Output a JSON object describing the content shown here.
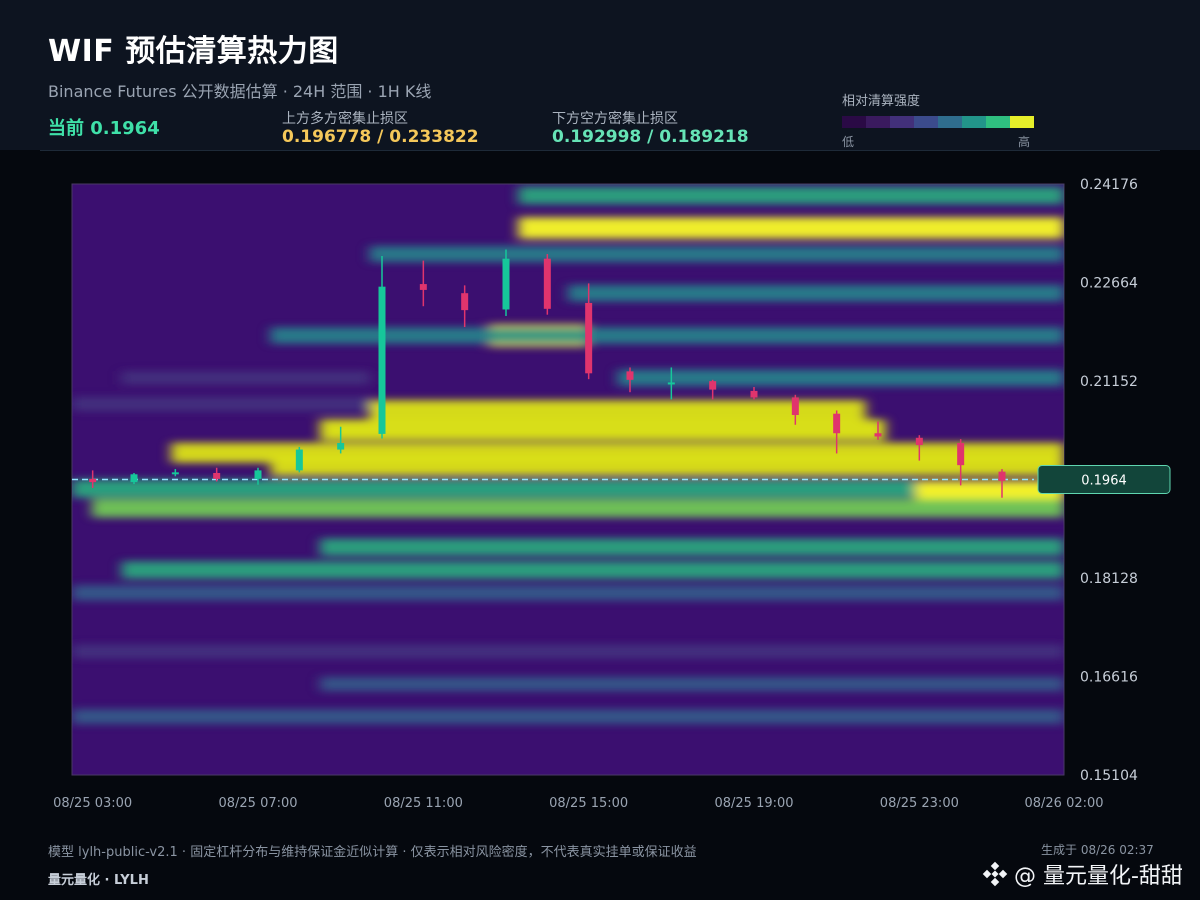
{
  "header": {
    "title": "WIF 预估清算热力图",
    "subtitle": "Binance Futures 公开数据估算 · 24H 范围 · 1H K线",
    "current": "当前 0.1964",
    "upper_zone_label": "上方多方密集止损区",
    "upper_zone_value": "0.196778 / 0.233822",
    "lower_zone_label": "下方空方密集止损区",
    "lower_zone_value": "0.192998 / 0.189218",
    "scale_title": "相对清算强度",
    "scale_low": "低",
    "scale_high": "高",
    "scale_colors": [
      "#2a0a45",
      "#3a1a5e",
      "#42307a",
      "#3b4b8c",
      "#2f6d8e",
      "#22958a",
      "#2fbf80",
      "#e6ef2a"
    ]
  },
  "chart_data": {
    "type": "heatmap",
    "title": "WIF 预估清算热力图",
    "ylabel": "",
    "xlabel": "",
    "ylim": [
      0.15104,
      0.24176
    ],
    "yticks": [
      "0.24176",
      "0.22664",
      "0.21152",
      "0.18128",
      "0.16616",
      "0.15104"
    ],
    "xticks": [
      "08/25 03:00",
      "08/25 07:00",
      "08/25 11:00",
      "08/25 15:00",
      "08/25 19:00",
      "08/25 23:00",
      "08/26 02:00"
    ],
    "current_price": 0.1964,
    "current_price_label": "0.1964",
    "colorscale": [
      "#3b0f70",
      "#453781",
      "#33638d",
      "#238a8d",
      "#29af7f",
      "#73d055",
      "#dce319",
      "#f2f02a"
    ],
    "up_color": "#16c79a",
    "down_color": "#e0346d",
    "candles": [
      {
        "t": "08/25 03:00",
        "o": 0.1965,
        "h": 0.1978,
        "l": 0.1951,
        "c": 0.196
      },
      {
        "t": "08/25 04:00",
        "o": 0.196,
        "h": 0.1974,
        "l": 0.1957,
        "c": 0.1972
      },
      {
        "t": "08/25 05:00",
        "o": 0.1972,
        "h": 0.198,
        "l": 0.1969,
        "c": 0.1975
      },
      {
        "t": "08/25 06:00",
        "o": 0.1974,
        "h": 0.1982,
        "l": 0.1961,
        "c": 0.1965
      },
      {
        "t": "08/25 07:00",
        "o": 0.1965,
        "h": 0.1982,
        "l": 0.1956,
        "c": 0.1978
      },
      {
        "t": "08/25 08:00",
        "o": 0.1978,
        "h": 0.2014,
        "l": 0.1975,
        "c": 0.201
      },
      {
        "t": "08/25 09:00",
        "o": 0.201,
        "h": 0.2045,
        "l": 0.2004,
        "c": 0.202
      },
      {
        "t": "08/25 10:00",
        "o": 0.2034,
        "h": 0.2307,
        "l": 0.2027,
        "c": 0.226
      },
      {
        "t": "08/25 11:00",
        "o": 0.2264,
        "h": 0.23,
        "l": 0.223,
        "c": 0.2255
      },
      {
        "t": "08/25 12:00",
        "o": 0.225,
        "h": 0.2262,
        "l": 0.2198,
        "c": 0.2224
      },
      {
        "t": "08/25 13:00",
        "o": 0.2225,
        "h": 0.2317,
        "l": 0.2215,
        "c": 0.2303
      },
      {
        "t": "08/25 14:00",
        "o": 0.2303,
        "h": 0.231,
        "l": 0.2217,
        "c": 0.2226
      },
      {
        "t": "08/25 15:00",
        "o": 0.2235,
        "h": 0.2265,
        "l": 0.2118,
        "c": 0.2127
      },
      {
        "t": "08/25 16:00",
        "o": 0.213,
        "h": 0.2136,
        "l": 0.2098,
        "c": 0.2117
      },
      {
        "t": "08/25 17:00",
        "o": 0.2113,
        "h": 0.2136,
        "l": 0.2087,
        "c": 0.2113
      },
      {
        "t": "08/25 18:00",
        "o": 0.2115,
        "h": 0.2117,
        "l": 0.2087,
        "c": 0.2102
      },
      {
        "t": "08/25 19:00",
        "o": 0.21,
        "h": 0.2106,
        "l": 0.2087,
        "c": 0.209
      },
      {
        "t": "08/25 20:00",
        "o": 0.209,
        "h": 0.2094,
        "l": 0.2048,
        "c": 0.2063
      },
      {
        "t": "08/25 21:00",
        "o": 0.2065,
        "h": 0.207,
        "l": 0.2004,
        "c": 0.2035
      },
      {
        "t": "08/25 22:00",
        "o": 0.2035,
        "h": 0.2053,
        "l": 0.2025,
        "c": 0.203
      },
      {
        "t": "08/25 23:00",
        "o": 0.2028,
        "h": 0.2032,
        "l": 0.1993,
        "c": 0.2017
      },
      {
        "t": "08/26 00:00",
        "o": 0.202,
        "h": 0.2026,
        "l": 0.1955,
        "c": 0.1986
      },
      {
        "t": "08/26 01:00",
        "o": 0.1976,
        "h": 0.198,
        "l": 0.1936,
        "c": 0.1962
      }
    ],
    "heat_bands": [
      {
        "price": 0.235,
        "t0": 0.45,
        "t1": 1.0,
        "intensity": 0.95
      },
      {
        "price": 0.24,
        "t0": 0.45,
        "t1": 1.0,
        "intensity": 0.55
      },
      {
        "price": 0.231,
        "t0": 0.3,
        "t1": 1.0,
        "intensity": 0.4
      },
      {
        "price": 0.225,
        "t0": 0.5,
        "t1": 1.0,
        "intensity": 0.45
      },
      {
        "price": 0.2185,
        "t0": 0.42,
        "t1": 0.52,
        "intensity": 1.0
      },
      {
        "price": 0.2185,
        "t0": 0.2,
        "t1": 1.0,
        "intensity": 0.45
      },
      {
        "price": 0.212,
        "t0": 0.55,
        "t1": 1.0,
        "intensity": 0.45
      },
      {
        "price": 0.207,
        "t0": 0.3,
        "t1": 0.8,
        "intensity": 0.85
      },
      {
        "price": 0.204,
        "t0": 0.25,
        "t1": 0.82,
        "intensity": 0.9
      },
      {
        "price": 0.2005,
        "t0": 0.1,
        "t1": 1.0,
        "intensity": 0.8
      },
      {
        "price": 0.1985,
        "t0": 0.2,
        "t1": 1.0,
        "intensity": 0.8
      },
      {
        "price": 0.1945,
        "t0": 0.85,
        "t1": 1.0,
        "intensity": 1.0
      },
      {
        "price": 0.195,
        "t0": 0.0,
        "t1": 0.85,
        "intensity": 0.6
      },
      {
        "price": 0.192,
        "t0": 0.02,
        "t1": 1.0,
        "intensity": 0.65
      },
      {
        "price": 0.186,
        "t0": 0.25,
        "t1": 1.0,
        "intensity": 0.55
      },
      {
        "price": 0.1825,
        "t0": 0.05,
        "t1": 1.0,
        "intensity": 0.55
      },
      {
        "price": 0.179,
        "t0": 0.0,
        "t1": 1.0,
        "intensity": 0.35
      },
      {
        "price": 0.17,
        "t0": 0.0,
        "t1": 1.0,
        "intensity": 0.2
      },
      {
        "price": 0.165,
        "t0": 0.25,
        "t1": 1.0,
        "intensity": 0.25
      },
      {
        "price": 0.16,
        "t0": 0.0,
        "t1": 1.0,
        "intensity": 0.3
      },
      {
        "price": 0.208,
        "t0": 0.0,
        "t1": 0.3,
        "intensity": 0.2
      },
      {
        "price": 0.212,
        "t0": 0.05,
        "t1": 0.3,
        "intensity": 0.15
      }
    ]
  },
  "footer": {
    "note": "模型 lylh-public-v2.1 · 固定杠杆分布与维持保证金近似计算 · 仅表示相对风险密度，不代表真实挂单或保证收益",
    "brand": "量元量化 · LYLH",
    "generated": "生成于 08/26 02:37",
    "watermark": "@ 量元量化-甜甜"
  }
}
